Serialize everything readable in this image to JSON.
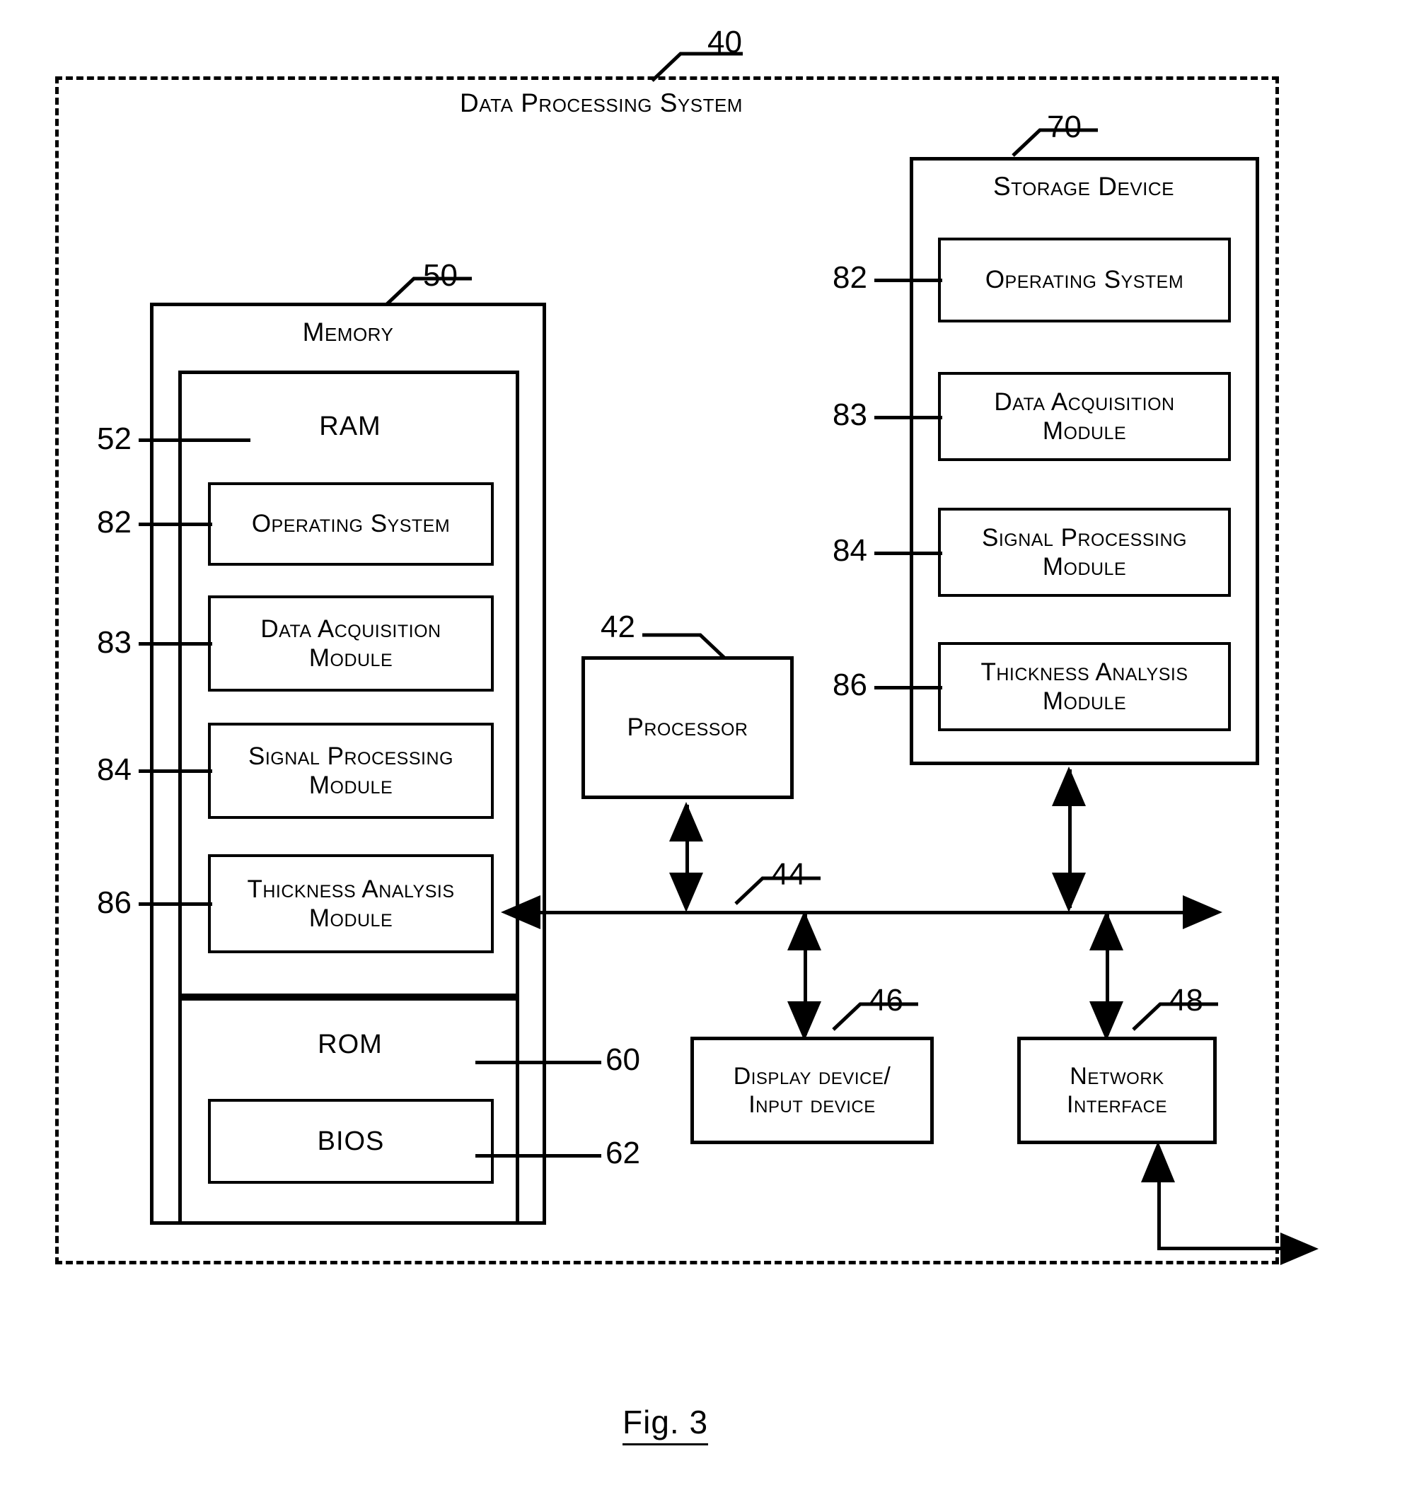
{
  "figure": {
    "caption": "Fig. 3"
  },
  "system": {
    "ref": "40",
    "title": "Data Processing System"
  },
  "memory": {
    "ref": "50",
    "title": "Memory",
    "ram": {
      "ref": "52",
      "title": "RAM",
      "modules": [
        {
          "ref": "82",
          "label": "Operating System"
        },
        {
          "ref": "83",
          "label": "Data Acquisition\nModule"
        },
        {
          "ref": "84",
          "label": "Signal Processing\nModule"
        },
        {
          "ref": "86",
          "label": "Thickness Analysis\nModule"
        }
      ]
    },
    "rom": {
      "ref": "60",
      "title": "ROM",
      "bios": {
        "ref": "62",
        "label": "BIOS"
      }
    }
  },
  "storage": {
    "ref": "70",
    "title": "Storage Device",
    "modules": [
      {
        "ref": "82",
        "label": "Operating System"
      },
      {
        "ref": "83",
        "label": "Data Acquisition\nModule"
      },
      {
        "ref": "84",
        "label": "Signal Processing\nModule"
      },
      {
        "ref": "86",
        "label": "Thickness Analysis\nModule"
      }
    ]
  },
  "processor": {
    "ref": "42",
    "label": "Processor"
  },
  "bus": {
    "ref": "44"
  },
  "display_input": {
    "ref": "46",
    "label": "Display device/\nInput device"
  },
  "network": {
    "ref": "48",
    "label": "Network\nInterface"
  },
  "colors": {
    "ink": "#000000",
    "paper": "#ffffff"
  }
}
